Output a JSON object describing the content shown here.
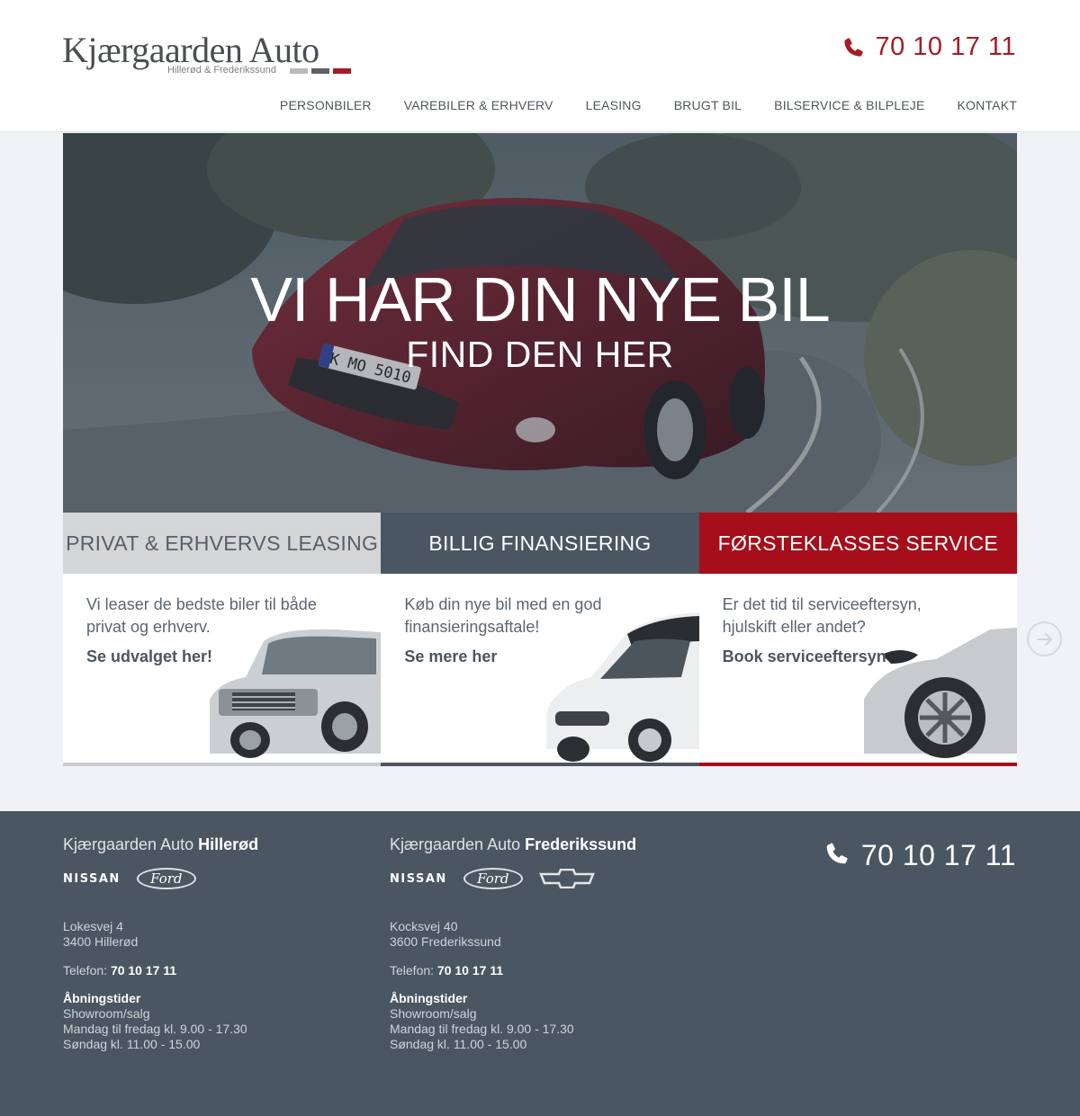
{
  "header": {
    "logo_title": "Kjærgaarden Auto",
    "logo_subtitle": "Hillerød & Frederikssund",
    "logo_bar_colors": [
      "#b8babc",
      "#5f6366",
      "#a51c24"
    ],
    "phone": "70 10 17 11"
  },
  "nav": {
    "items": [
      {
        "label": "PERSONBILER"
      },
      {
        "label": "VAREBILER & ERHVERV"
      },
      {
        "label": "LEASING"
      },
      {
        "label": "BRUGT BIL"
      },
      {
        "label": "BILSERVICE & BILPLEJE"
      },
      {
        "label": "KONTAKT"
      }
    ]
  },
  "hero": {
    "title": "VI HAR DIN NYE BIL",
    "subtitle": "FIND DEN HER",
    "plate": "K MO 5010"
  },
  "features": [
    {
      "heading": "PRIVAT & ERHVERVS LEASING",
      "text": "Vi leaser de bedste biler til både privat og erhverv.",
      "link": "Se udvalget her!",
      "head_bg": "#d4d5d6",
      "head_color": "#56606a",
      "bar": "#c9cbcd"
    },
    {
      "heading": "BILLIG FINANSIERING",
      "text": "Køb din nye bil med en god finansieringsaftale!",
      "link": "Se mere her",
      "head_bg": "#4a5661",
      "head_color": "#ffffff",
      "bar": "#4a5661"
    },
    {
      "heading": "FØRSTEKLASSES SERVICE",
      "text": "Er det tid til serviceeftersyn, hjulskift eller andet?",
      "link": "Book serviceeftersyn",
      "head_bg": "#a50e1a",
      "head_color": "#ffffff",
      "bar": "#a50e1a"
    }
  ],
  "footer": {
    "branches": [
      {
        "name_prefix": "Kjærgaarden Auto",
        "name_city": "Hillerød",
        "brands": [
          "NISSAN",
          "Ford"
        ],
        "address_line1": "Lokesvej 4",
        "address_line2": "3400 Hillerød",
        "phone_label": "Telefon:",
        "phone": "70 10 17 11",
        "hours_heading": "Åbningstider",
        "hours_line1": "Showroom/salg",
        "hours_line2": "Mandag til fredag kl. 9.00 - 17.30",
        "hours_line3": "Søndag kl. 11.00 - 15.00"
      },
      {
        "name_prefix": "Kjærgaarden Auto",
        "name_city": "Frederikssund",
        "brands": [
          "NISSAN",
          "Ford",
          "Chevrolet"
        ],
        "address_line1": "Kocksvej 40",
        "address_line2": "3600 Frederikssund",
        "phone_label": "Telefon:",
        "phone": "70 10 17 11",
        "hours_heading": "Åbningstider",
        "hours_line1": "Showroom/salg",
        "hours_line2": "Mandag til fredag kl. 9.00 - 17.30",
        "hours_line3": "Søndag kl. 11.00 - 15.00"
      }
    ],
    "phone": "70 10 17 11"
  },
  "colors": {
    "accent_red": "#a51c24",
    "slate": "#4a5661"
  },
  "icons": {
    "phone": "phone-icon",
    "next": "arrow-right-circle-icon"
  }
}
